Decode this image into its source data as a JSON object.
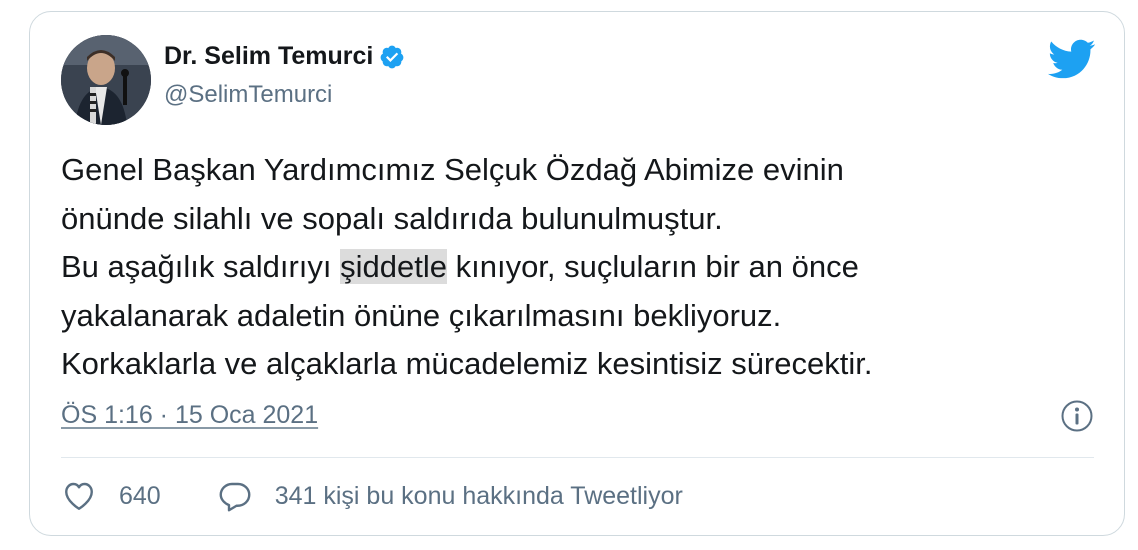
{
  "author": {
    "name": "Dr. Selim Temurci",
    "handle": "@SelimTemurci",
    "verified_icon": "verified-badge-icon"
  },
  "tweet": {
    "part1": "Genel Başkan Yardımcımız Selçuk Özdağ Abimize evinin\nönünde silahlı ve sopalı saldırıda bulunulmuştur.\nBu aşağılık saldırıyı ",
    "highlight": "şiddetle",
    "part2": " kınıyor, suçluların bir an önce\nyakalanarak adaletin önüne çıkarılmasını bekliyoruz.\nKorkaklarla ve alçaklarla mücadelemiz kesintisiz sürecektir.",
    "timestamp": "ÖS 1:16 · 15 Oca 2021"
  },
  "actions": {
    "like_count": "640",
    "reply_text": "341 kişi bu konu hakkında Tweetliyor"
  },
  "colors": {
    "brand_blue": "#1da1f2",
    "secondary_text": "#5b7083",
    "highlight_bg": "#dcdcdc"
  }
}
